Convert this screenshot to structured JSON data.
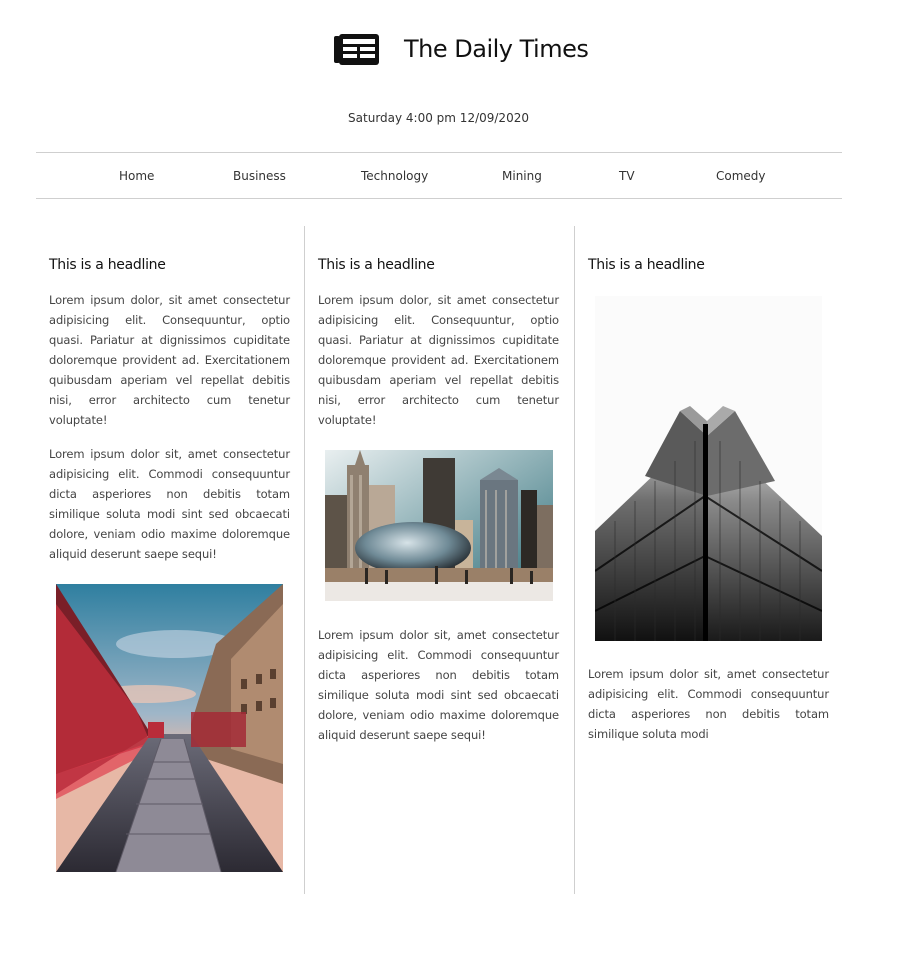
{
  "site": {
    "title": "The Daily Times",
    "logo_icon": "newspaper-icon",
    "dateline": "Saturday 4:00 pm 12/09/2020"
  },
  "nav": {
    "items": [
      {
        "label": "Home"
      },
      {
        "label": "Business"
      },
      {
        "label": "Technology"
      },
      {
        "label": "Mining"
      },
      {
        "label": "TV"
      },
      {
        "label": "Comedy"
      }
    ]
  },
  "articles": [
    {
      "headline": "This is a headline",
      "paragraphs": [
        "Lorem ipsum dolor, sit amet consectetur adipisicing elit. Consequuntur, optio quasi. Pariatur at dignissimos cupiditate doloremque provident ad. Exercitationem quibusdam aperiam vel repellat debitis nisi, error architecto cum tenetur voluptate!",
        "Lorem ipsum dolor sit, amet consectetur adipisicing elit. Commodi consequuntur dicta asperiores non debitis totam similique soluta modi sint sed obcaecati dolore, veniam odio maxime doloremque aliquid deserunt saepe sequi!"
      ],
      "image": "london-street-bus-photo"
    },
    {
      "headline": "This is a headline",
      "paragraphs": [
        "Lorem ipsum dolor, sit amet consectetur adipisicing elit. Consequuntur, optio quasi. Pariatur at dignissimos cupiditate doloremque provident ad. Exercitationem quibusdam aperiam vel repellat debitis nisi, error architecto cum tenetur voluptate!",
        "Lorem ipsum dolor sit, amet consectetur adipisicing elit. Commodi consequuntur dicta asperiores non debitis totam similique soluta modi sint sed obcaecati dolore, veniam odio maxime doloremque aliquid deserunt saepe sequi!"
      ],
      "image": "chicago-bean-skyline-photo"
    },
    {
      "headline": "This is a headline",
      "paragraphs": [
        "Lorem ipsum dolor sit, amet consectetur adipisicing elit. Commodi consequuntur dicta asperiores non debitis totam similique soluta modi"
      ],
      "image": "skyscraper-upward-photo"
    }
  ]
}
